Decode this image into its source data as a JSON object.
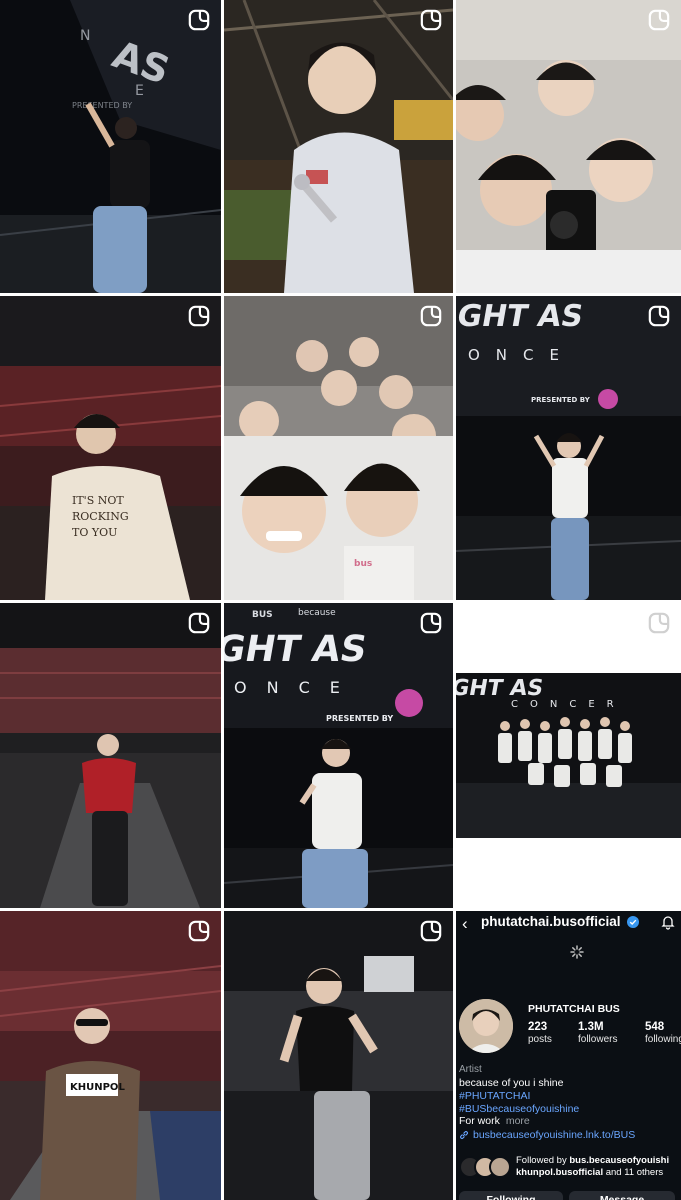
{
  "grid": {
    "posts": [
      {
        "kind": "reel",
        "image": "stage-pose-pointing-up"
      },
      {
        "kind": "reel",
        "image": "holding-microphone-portrait"
      },
      {
        "kind": "reel",
        "image": "group-mirror-selfie"
      },
      {
        "kind": "reel",
        "image": "arena-seats-portrait"
      },
      {
        "kind": "reel",
        "image": "group-selfie-smiling"
      },
      {
        "kind": "reel",
        "image": "stage-rock-hands-pose"
      },
      {
        "kind": "reel",
        "image": "red-jacket-stage"
      },
      {
        "kind": "reel",
        "image": "peace-sign-stage"
      },
      {
        "kind": "reel",
        "image": "group-stage-photo"
      },
      {
        "kind": "reel",
        "image": "khunpol-sign-arena"
      },
      {
        "kind": "reel",
        "image": "tank-top-arena"
      }
    ],
    "reel_icon": "reels-icon",
    "colors": {
      "reel_icon": "#ffffff"
    }
  },
  "profile": {
    "handle": "phutatchai.busofficial",
    "back_icon": "back-arrow-icon",
    "verified_icon": "verified-badge-icon",
    "bell_icon": "notification-bell-icon",
    "display_name": "PHUTATCHAI BUS",
    "stats": [
      {
        "value": "223",
        "label": "posts"
      },
      {
        "value": "1.3M",
        "label": "followers"
      },
      {
        "value": "548",
        "label": "following"
      }
    ],
    "category": "Artist",
    "bio_line": "because of you i shine",
    "hashtags": [
      "#PHUTATCHAI",
      "#BUSbecauseofyouishine"
    ],
    "work_line": "For work",
    "more_label": "more",
    "link": "busbecauseofyouishine.lnk.to/BUS",
    "followed_by_prefix": "Followed by",
    "followed_by_user1": "bus.becauseofyouishi",
    "followed_by_user2": "khunpol.busofficial",
    "followed_by_suffix": "and 11 others",
    "buttons": {
      "following": "Following",
      "message": "Message"
    },
    "colors": {
      "background": "#0b0f14",
      "link": "#6aa6ff",
      "verified": "#3897f0",
      "button_bg": "#262a31"
    }
  }
}
